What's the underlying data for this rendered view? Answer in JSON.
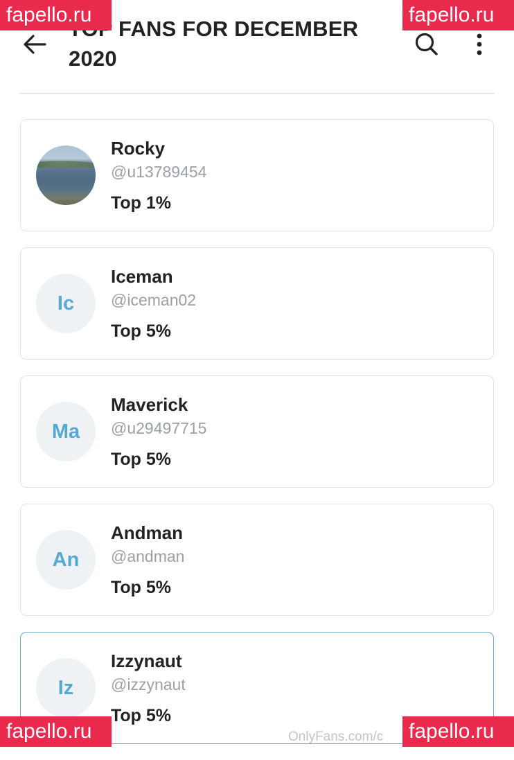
{
  "header": {
    "title": "TOP FANS FOR DECEMBER 2020"
  },
  "icons": {
    "back": "arrow-left-icon",
    "search": "search-icon",
    "more": "more-vertical-icon"
  },
  "fans": [
    {
      "name": "Rocky",
      "handle": "@u13789454",
      "rank": "Top 1%",
      "initials": "",
      "avatar": "photo"
    },
    {
      "name": "Iceman",
      "handle": "@iceman02",
      "rank": "Top 5%",
      "initials": "Ic",
      "avatar": "initials"
    },
    {
      "name": "Maverick",
      "handle": "@u29497715",
      "rank": "Top 5%",
      "initials": "Ma",
      "avatar": "initials"
    },
    {
      "name": "Andman",
      "handle": "@andman",
      "rank": "Top 5%",
      "initials": "An",
      "avatar": "initials"
    },
    {
      "name": "Izzynaut",
      "handle": "@izzynaut",
      "rank": "Top 5%",
      "initials": "Iz",
      "avatar": "initials"
    }
  ],
  "footer": {
    "url": "OnlyFans.com/c"
  },
  "watermark": {
    "text": "fapello.ru",
    "color": "#ea2a4d"
  },
  "colors": {
    "initials": "#56a9d2",
    "selected_border": "#6fa8c9"
  }
}
